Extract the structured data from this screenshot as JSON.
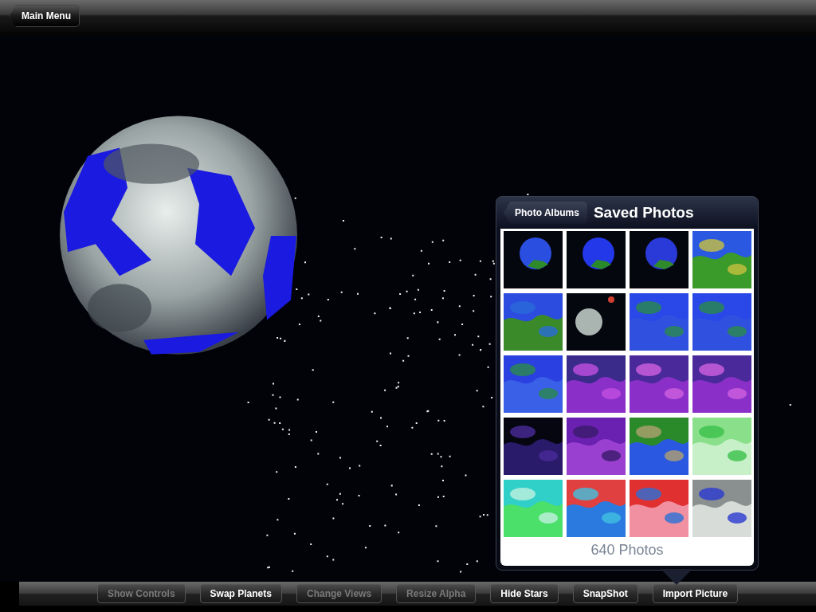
{
  "nav_bar": {
    "back_button": "Main Menu"
  },
  "popover": {
    "back_button": "Photo Albums",
    "title": "Saved Photos",
    "photo_count": "640 Photos"
  },
  "toolbar": [
    {
      "label": "Show Controls",
      "disabled": true
    },
    {
      "label": "Swap Planets",
      "disabled": false
    },
    {
      "label": "Change Views",
      "disabled": true
    },
    {
      "label": "Resize Alpha",
      "disabled": true
    },
    {
      "label": "Hide Stars",
      "disabled": false
    },
    {
      "label": "SnapShot",
      "disabled": false
    },
    {
      "label": "Import Picture",
      "disabled": false
    }
  ]
}
